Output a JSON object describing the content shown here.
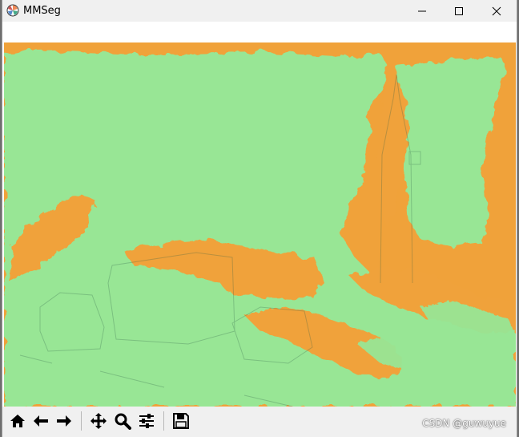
{
  "window": {
    "title": "MMSeg"
  },
  "toolbar": {
    "buttons": [
      {
        "name": "home-icon"
      },
      {
        "name": "back-icon"
      },
      {
        "name": "forward-icon"
      },
      {
        "name": "pan-icon"
      },
      {
        "name": "zoom-icon"
      },
      {
        "name": "configure-subplots-icon"
      },
      {
        "name": "save-icon"
      }
    ]
  },
  "segmentation": {
    "classes": [
      {
        "color": "#f0a23a"
      },
      {
        "color": "#98e695"
      }
    ]
  },
  "watermark": "CSDN @guwuyue"
}
